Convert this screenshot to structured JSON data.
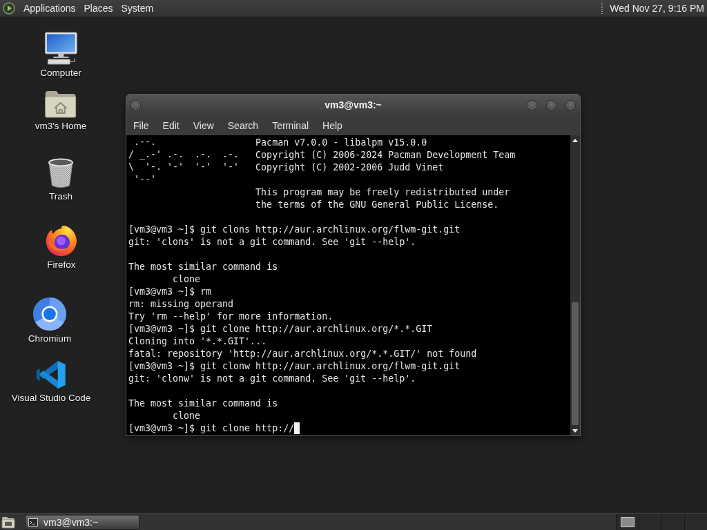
{
  "top_panel": {
    "menus": [
      "Applications",
      "Places",
      "System"
    ],
    "clock": "Wed Nov 27, 9:16 PM"
  },
  "desktop_icons": [
    {
      "kind": "computer",
      "label": "Computer"
    },
    {
      "kind": "home",
      "label": "vm3's Home"
    },
    {
      "kind": "trash",
      "label": "Trash"
    },
    {
      "kind": "firefox",
      "label": "Firefox"
    },
    {
      "kind": "chromium",
      "label": "Chromium"
    },
    {
      "kind": "vscode",
      "label": "Visual Studio Code"
    }
  ],
  "terminal_window": {
    "title": "vm3@vm3:~",
    "menu": [
      "File",
      "Edit",
      "View",
      "Search",
      "Terminal",
      "Help"
    ],
    "banner": {
      "art": [
        " .--.",
        "/ _.-' .-.  .-.  .-.",
        "\\  '-. '-'  '-'  '-'",
        " '--'"
      ],
      "info": [
        [
          "Pacman v7.0.0 - libalpm v15.0.0",
          "Copyright (C) 2006-2024 Pacman Development Team",
          "Copyright (C) 2002-2006 Judd Vinet"
        ],
        [
          "This program may be freely redistributed under",
          "the terms of the GNU General Public License."
        ]
      ]
    },
    "blocks": [
      [
        "[vm3@vm3 ~]$ git clons http://aur.archlinux.org/flwm-git.git",
        "git: 'clons' is not a git command. See 'git --help'."
      ],
      [
        "The most similar command is",
        "        clone",
        "[vm3@vm3 ~]$ rm",
        "rm: missing operand",
        "Try 'rm --help' for more information.",
        "[vm3@vm3 ~]$ git clone http://aur.archlinux.org/*.*.GIT",
        "Cloning into '*.*.GIT'...",
        "fatal: repository 'http://aur.archlinux.org/*.*.GIT/' not found",
        "[vm3@vm3 ~]$ git clonw http://aur.archlinux.org/flwm-git.git",
        "git: 'clonw' is not a git command. See 'git --help'."
      ],
      [
        "The most similar command is",
        "        clone",
        "[vm3@vm3 ~]$ git clone http://"
      ]
    ],
    "cursor": true
  },
  "bottom_panel": {
    "tasks": [
      {
        "label": "vm3@vm3:~",
        "selected": true
      }
    ],
    "workspaces": [
      {
        "has_window": true
      },
      {
        "has_window": false
      },
      {
        "has_window": false
      },
      {
        "has_window": false
      }
    ]
  }
}
